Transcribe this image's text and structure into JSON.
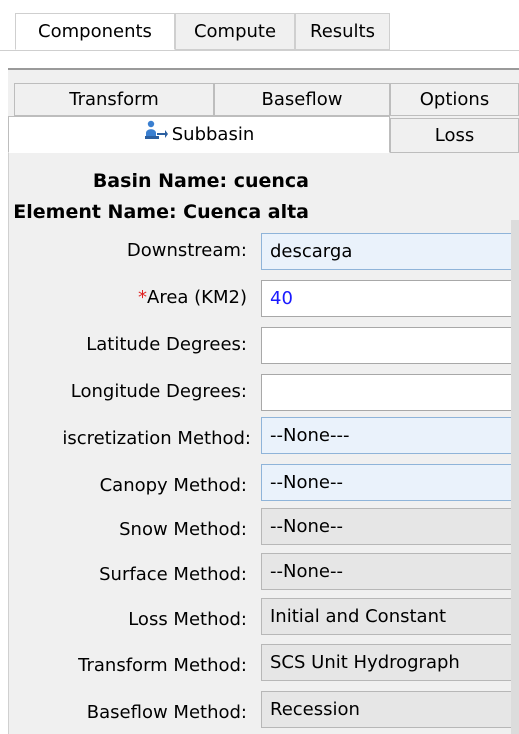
{
  "top_tabs": [
    "Components",
    "Compute",
    "Results"
  ],
  "inner_tabs": {
    "row1": [
      "Transform",
      "Baseflow",
      "Options"
    ],
    "selected": "Subbasin",
    "loss": "Loss"
  },
  "info": {
    "basin": "Basin Name: cuenca",
    "element": "Element Name: Cuenca alta"
  },
  "fields": [
    {
      "label": "Downstream:",
      "value": "descarga"
    },
    {
      "label": "Area (KM2)",
      "required_mark": "*",
      "value": "40"
    },
    {
      "label": "Latitude Degrees:",
      "value": ""
    },
    {
      "label": "Longitude Degrees:",
      "value": ""
    },
    {
      "label": "iscretization Method:",
      "value": "--None---"
    },
    {
      "label": "Canopy Method:",
      "value": "--None--"
    },
    {
      "label": "Snow Method:",
      "value": "--None--"
    },
    {
      "label": "Surface Method:",
      "value": "--None--"
    },
    {
      "label": "Loss Method:",
      "value": "Initial and Constant"
    },
    {
      "label": "Transform Method:",
      "value": "SCS Unit Hydrograph"
    },
    {
      "label": "Baseflow Method:",
      "value": "Recession"
    }
  ],
  "icons": {
    "subbasin": "subbasin-icon"
  },
  "colors": {
    "required": "#e02020",
    "value_blue": "#1a1aff",
    "field_blue": "#eaf2fb",
    "field_gray": "#e6e6e6"
  }
}
